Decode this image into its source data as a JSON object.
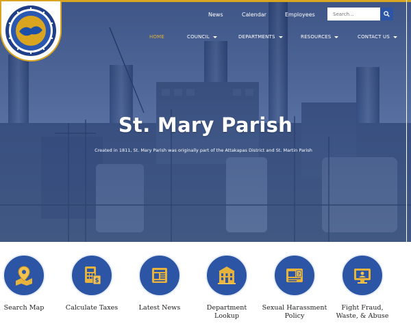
{
  "header": {
    "logo_alt": "St. Mary Parish seal",
    "utility_links": [
      "News",
      "Calendar",
      "Employees"
    ],
    "search": {
      "placeholder": "Search..."
    },
    "main_nav": [
      {
        "label": "HOME",
        "active": true,
        "dropdown": false
      },
      {
        "label": "COUNCIL",
        "active": false,
        "dropdown": true
      },
      {
        "label": "DEPARTMENTS",
        "active": false,
        "dropdown": true
      },
      {
        "label": "RESOURCES",
        "active": false,
        "dropdown": true
      },
      {
        "label": "CONTACT US",
        "active": false,
        "dropdown": true
      }
    ]
  },
  "hero": {
    "title": "St. Mary Parish",
    "subtitle": "Created in 1811, St. Mary Parish was originally part of the Attakapas District and St. Martin Parish"
  },
  "quick_links": [
    {
      "label": "Search Map",
      "icon": "map-pin-icon"
    },
    {
      "label": "Calculate Taxes",
      "icon": "calculator-icon"
    },
    {
      "label": "Latest News",
      "icon": "newspaper-icon"
    },
    {
      "label": "Department Lookup",
      "icon": "building-icon"
    },
    {
      "label": "Sexual Harassment Policy",
      "icon": "policy-document-icon"
    },
    {
      "label": "Fight Fraud, Waste, & Abuse",
      "icon": "computer-user-icon"
    }
  ],
  "colors": {
    "accent_gold": "#d9a521",
    "brand_blue": "#2c55a6",
    "icon_gold": "#e7b33c"
  }
}
